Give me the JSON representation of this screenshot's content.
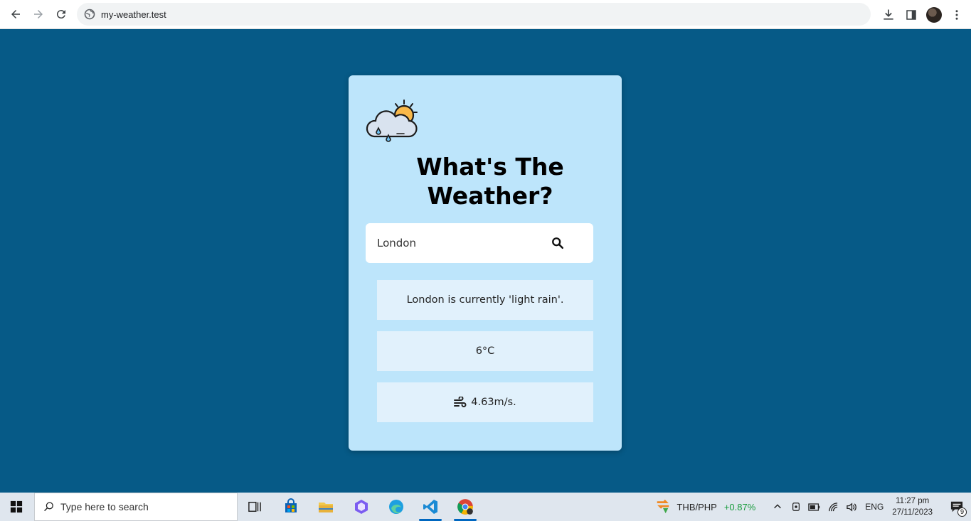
{
  "browser": {
    "url": "my-weather.test"
  },
  "app": {
    "title_line1": "What's The",
    "title_line2": "Weather?",
    "search": {
      "value": "London"
    },
    "result": {
      "description": "London is currently 'light rain'.",
      "temperature": "6°C",
      "wind": "4.63m/s."
    },
    "colors": {
      "page_background": "#065a87",
      "card_background": "#bde5fb",
      "info_box_background": "#e1f1fc"
    }
  },
  "taskbar": {
    "search_placeholder": "Type here to search",
    "ticker": {
      "pair": "THB/PHP",
      "change": "+0.87%"
    },
    "language": "ENG",
    "time": "11:27 pm",
    "date": "27/11/2023",
    "notification_count": "9"
  }
}
